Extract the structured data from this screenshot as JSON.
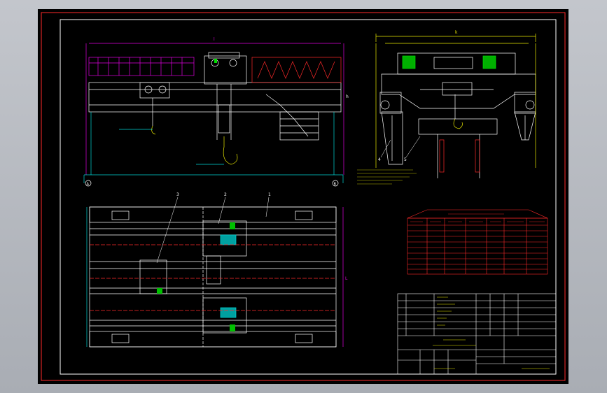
{
  "drawing": {
    "dims": {
      "main_span": "l",
      "right_width": "k",
      "rail_height": "h",
      "plan_height": "L"
    },
    "balloons": [
      "1",
      "2",
      "3",
      "4",
      "5"
    ],
    "grid_marks": [
      "A",
      "B"
    ]
  },
  "colors": {
    "sheet_bg": "#000000",
    "line": "#ffffff",
    "accent_red": "#ff2a2a",
    "accent_magenta": "#e100e1",
    "accent_green": "#00e000",
    "accent_cyan": "#00d7d7",
    "accent_yellow": "#e8e800"
  },
  "icons": {
    "hook": "crane-hook-icon",
    "trolley": "trolley-icon",
    "pulley": "pulley-icon"
  }
}
